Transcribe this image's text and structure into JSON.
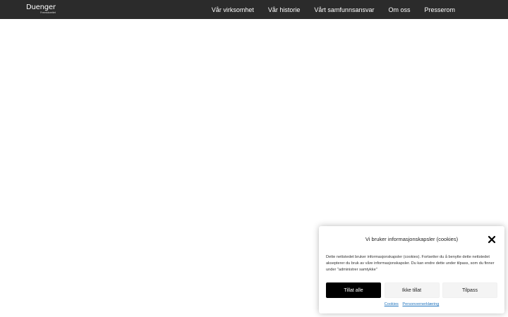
{
  "header": {
    "logo_text": "Duenger",
    "logo_subtext": "Fremtidsrettet",
    "nav": [
      {
        "label": "Vår virksomhet"
      },
      {
        "label": "Vår historie"
      },
      {
        "label": "Vårt samfunnsansvar"
      },
      {
        "label": "Om oss"
      },
      {
        "label": "Presserom"
      }
    ]
  },
  "cookie_banner": {
    "title": "Vi bruker informasjonskapsler (cookies)",
    "text": "Dette nettstedet bruker informasjonskapsler (cookies). Fortsetter du å benytte dette nettstedet aksepterer du bruk av våre informasjonskapsler. Du kan endre dette under tilpass, som du finner under \"administrer samtykke\"",
    "buttons": {
      "accept": "Tillat alle",
      "deny": "Ikke tillat",
      "customize": "Tilpass"
    },
    "links": {
      "cookies": "Cookies",
      "privacy": "Personvernerklæring"
    }
  },
  "colors": {
    "header_bg": "#2b2b2b",
    "accent_button": "#000000",
    "link": "#1e73be"
  }
}
